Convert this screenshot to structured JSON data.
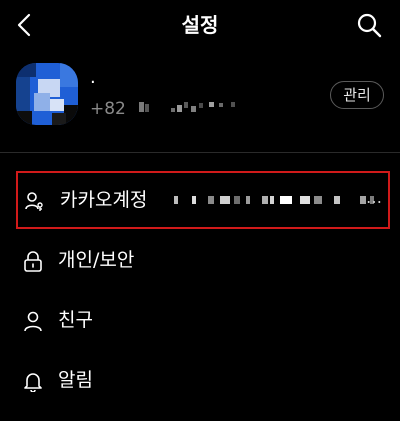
{
  "header": {
    "title": "설정",
    "back_icon": "chevron-left-icon",
    "search_icon": "search-icon"
  },
  "profile": {
    "name": "·",
    "phone_prefix": "+82",
    "manage_label": "관리"
  },
  "menu": {
    "items": [
      {
        "label": "카카오계정",
        "icon": "account-icon",
        "extra": "…"
      },
      {
        "label": "개인/보안",
        "icon": "lock-icon"
      },
      {
        "label": "친구",
        "icon": "person-icon"
      },
      {
        "label": "알림",
        "icon": "bell-icon"
      }
    ]
  },
  "colors": {
    "background": "#000000",
    "text": "#ffffff",
    "muted": "#8a8a8a",
    "highlight_border": "#d11a1a",
    "avatar_blue": "#1f5fd6"
  }
}
